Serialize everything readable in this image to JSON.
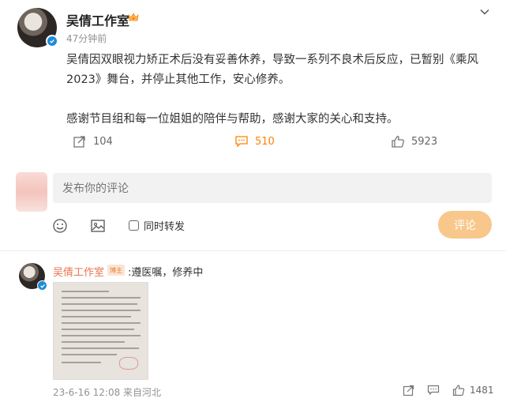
{
  "post": {
    "author": "吴倩工作室",
    "author_badge_icon": "crown-icon",
    "time": "47分钟前",
    "paragraphs": [
      "吴倩因双眼视力矫正术后没有妥善休养，导致一系列不良术后反应，已暂别《乘风2023》舞台，并停止其他工作，安心修养。",
      "感谢节目组和每一位姐姐的陪伴与帮助，感谢大家的关心和支持。"
    ],
    "actions": {
      "repost_count": "104",
      "comment_count": "510",
      "like_count": "5923"
    }
  },
  "comment_box": {
    "placeholder": "发布你的评论",
    "repost_label": "同时转发",
    "submit_label": "评论"
  },
  "reply": {
    "author": "吴倩工作室",
    "badge": "博主",
    "text": ":遵医嘱，修养中",
    "meta": "23-6-16 12:08 来自河北",
    "like_count": "1481"
  },
  "colors": {
    "accent_orange": "#ff8200",
    "reply_name": "#eb7350",
    "submit_button": "#f8c78b",
    "verify_blue": "#1e8bd8"
  }
}
